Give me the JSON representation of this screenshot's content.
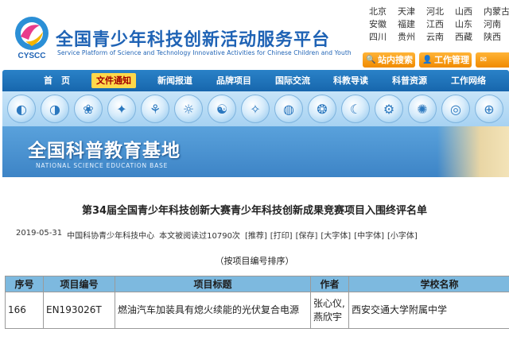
{
  "header": {
    "title": "全国青少年科技创新活动服务平台",
    "subtitle": "Service Platform of Science and Technology Innovative Activities for Chinese Children and Youth",
    "logo_text": "CYSCC",
    "regions": [
      "北京",
      "天津",
      "河北",
      "山西",
      "内蒙古",
      "安徽",
      "福建",
      "江西",
      "山东",
      "河南",
      "四川",
      "贵州",
      "云南",
      "西藏",
      "陕西"
    ],
    "buttons": {
      "search": "站内搜索",
      "work": "工作管理"
    }
  },
  "nav": {
    "items": [
      "首　页",
      "文件通知",
      "新闻报道",
      "品牌项目",
      "国际交流",
      "科教导读",
      "科普资源",
      "工作网络"
    ],
    "active_index": 1
  },
  "banner": {
    "title": "全国科普教育基地",
    "subtitle": "NATIONAL SCIENCE EDUCATION BASE"
  },
  "article": {
    "title": "第34届全国青少年科技创新大赛青少年科技创新成果竞赛项目入围终评名单",
    "date": "2019-05-31",
    "source": "中国科协青少年科技中心",
    "views": "本文被阅读过10790次",
    "tools": [
      "[推荐]",
      "[打印]",
      "[保存]",
      "[大字体]",
      "[中字体]",
      "[小字体]"
    ],
    "sort_note": "（按项目编号排序）"
  },
  "table": {
    "headers": [
      "序号",
      "项目编号",
      "项目标题",
      "作者",
      "学校名称"
    ],
    "rows": [
      [
        "166",
        "EN193026T",
        "燃油汽车加装具有熄火续能的光伏复合电源",
        "张心仪, 燕欣宇",
        "西安交通大学附属中学"
      ]
    ]
  },
  "colors": {
    "brand_blue": "#1f63b5",
    "nav_blue": "#1766ad",
    "accent_orange": "#f08a00",
    "active_tab": "#ffd84a",
    "table_header": "#7db9df"
  }
}
